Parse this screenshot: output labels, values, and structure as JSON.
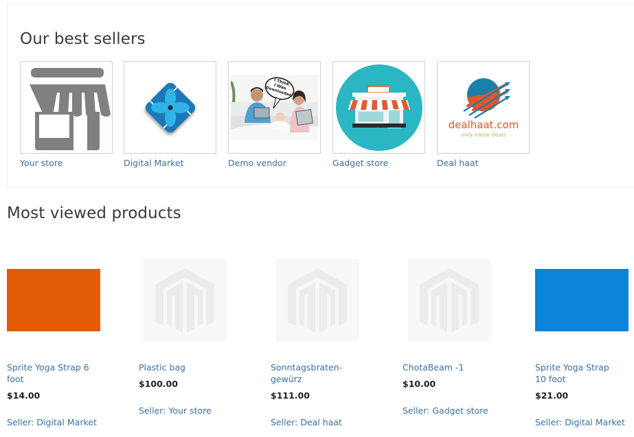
{
  "best_sellers": {
    "title": "Our best sellers",
    "sellers": [
      {
        "name": "Your store",
        "logo": "storefront-icon"
      },
      {
        "name": "Digital Market",
        "logo": "diamond-flower-logo"
      },
      {
        "name": "Demo vendor",
        "logo": "family-photo",
        "bubble_text": "I Think I Was Downloaded"
      },
      {
        "name": "Gadget store",
        "logo": "shop-circle-logo"
      },
      {
        "name": "Deal haat",
        "logo": "dealhaat-logo",
        "logo_text": "dealhaat.com",
        "logo_tagline": "only value deals"
      }
    ]
  },
  "most_viewed": {
    "title": "Most viewed products",
    "products": [
      {
        "name": "Sprite Yoga Strap 6 foot",
        "price": "$14.00",
        "seller": "Seller: Digital Market",
        "image": "swatch",
        "color": "#e35b06"
      },
      {
        "name": "Plastic bag",
        "price": "$100.00",
        "seller": "Seller: Your store",
        "image": "placeholder"
      },
      {
        "name": "Sonntagsbraten-gewürz",
        "price": "$111.00",
        "seller": "Seller: Deal haat",
        "image": "placeholder"
      },
      {
        "name": "ChotaBeam -1",
        "price": "$10.00",
        "seller": "Seller: Gadget store",
        "image": "placeholder"
      },
      {
        "name": "Sprite Yoga Strap 10 foot",
        "price": "$21.00",
        "seller": "Seller: Digital Market",
        "image": "swatch",
        "color": "#0a84d6"
      }
    ]
  }
}
